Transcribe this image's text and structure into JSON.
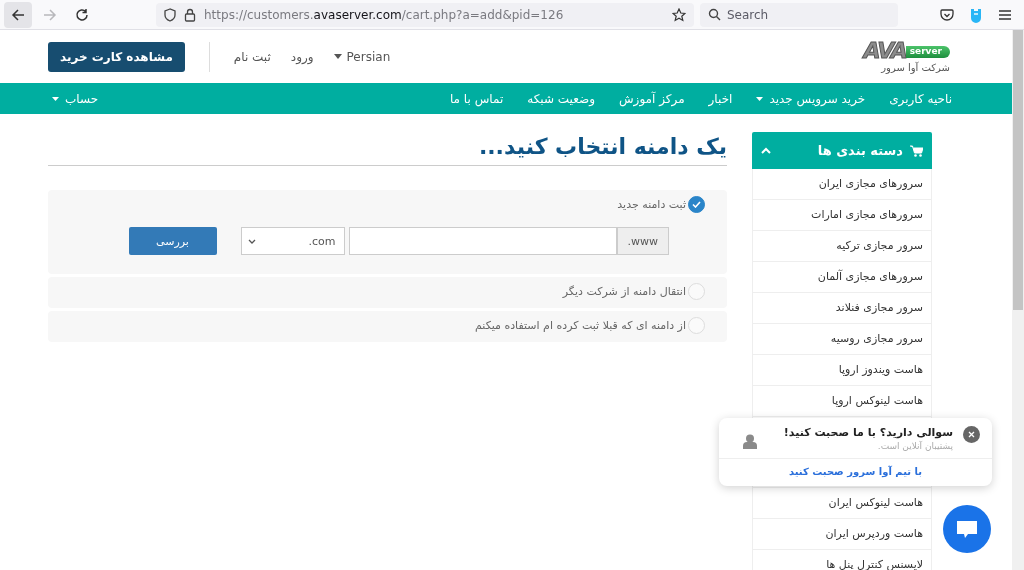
{
  "browser": {
    "url": {
      "scheme": "https://customers.",
      "domain": "avaserver.com",
      "path": "/cart.php?a=add&pid=126"
    },
    "search_placeholder": "Search",
    "forward_disabled": true
  },
  "header": {
    "logo": {
      "mark": "AVA",
      "tag": "server",
      "name": "شرکت آوا سرور"
    },
    "language": "Persian",
    "login": "ورود",
    "register": "ثبت نام",
    "cart_button": "مشاهده کارت خرید"
  },
  "nav": {
    "items": [
      {
        "label": "ناحیه کاربری",
        "dropdown": false
      },
      {
        "label": "خرید سرویس جدید",
        "dropdown": true
      },
      {
        "label": "اخبار",
        "dropdown": false
      },
      {
        "label": "مرکز آموزش",
        "dropdown": false
      },
      {
        "label": "وضعیت شبکه",
        "dropdown": false
      },
      {
        "label": "تماس با ما",
        "dropdown": false
      }
    ],
    "account": {
      "label": "حساب",
      "dropdown": true
    }
  },
  "sidebar": {
    "title": "دسته بندی ها",
    "expanded": true,
    "items": [
      "سرورهای مجازی ایران",
      "سرورهای مجازی امارات",
      "سرور مجازی ترکیه",
      "سرورهای مجازی آلمان",
      "سرور مجازی فنلاند",
      "سرور مجازی روسیه",
      "هاست ویندوز اروپا",
      "هاست لینوکس اروپا",
      "هاست لینوکس ایران",
      "هاست وردپرس ایران",
      "لایسنس کنترل پنل ها"
    ]
  },
  "main": {
    "title": "یک دامنه انتخاب کنید...",
    "options": [
      {
        "label": "ثبت دامنه جدید",
        "selected": true
      },
      {
        "label": "انتقال دامنه از شرکت دیگر",
        "selected": false
      },
      {
        "label": "از دامنه ای که قبلا ثبت کرده ام استفاده میکنم",
        "selected": false
      }
    ],
    "domain": {
      "prefix": ".www",
      "tld": "com.",
      "button": "بررسی"
    }
  },
  "chat": {
    "title": "سوالی دارید؟ با ما صحبت کنید!",
    "subtitle": "پشتیبان آنلاین است.",
    "link": "با تیم آوا سرور صحبت کنید"
  }
}
